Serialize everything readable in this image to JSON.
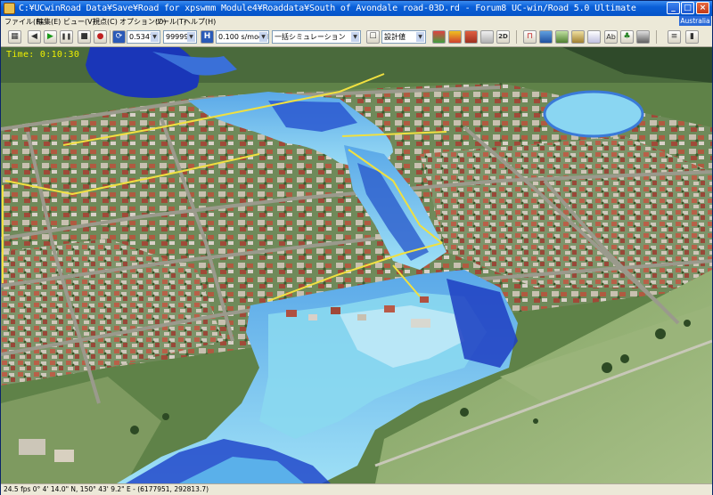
{
  "window": {
    "title": "C:¥UCwinRoad Data¥Save¥Road for xpswmm Module4¥Roaddata¥South of Avondale road-03D.rd - Forum8 UC-win/Road 5.0 Ultimate",
    "minimize": "_",
    "maximize": "□",
    "close": "×"
  },
  "menu": {
    "items": [
      "ファイル(F)",
      "編集(E)",
      "ビュー(V)",
      "視点(C)",
      "オプション(O)",
      "ツール(T)",
      "ヘルプ(H)"
    ],
    "region_badge": "Australia"
  },
  "toolbar": {
    "speed_value": "0.5347",
    "frame_value": "99999.",
    "step_value": "0.100 s/model",
    "sim_mode": "一括シミュレーション",
    "display_mode": "設計値",
    "view_2d": "2D",
    "h_label": "H",
    "icons": {
      "prev": "◀",
      "play": "▶",
      "pause": "❚❚",
      "stop": "■",
      "record": "●"
    }
  },
  "viewport": {
    "time_label": "Time: 0:10:30"
  },
  "status": {
    "text": "24.5 fps    0°  4' 14.0\" N, 150°  43' 9.2\" E  -  (6177951, 292813.7)"
  },
  "colors": {
    "title_bar": "#0554c8",
    "water_deep": "#1838c8",
    "water_shallow": "#8ad8f0",
    "road_overlay": "#f0e040",
    "grass": "#6a9050"
  }
}
